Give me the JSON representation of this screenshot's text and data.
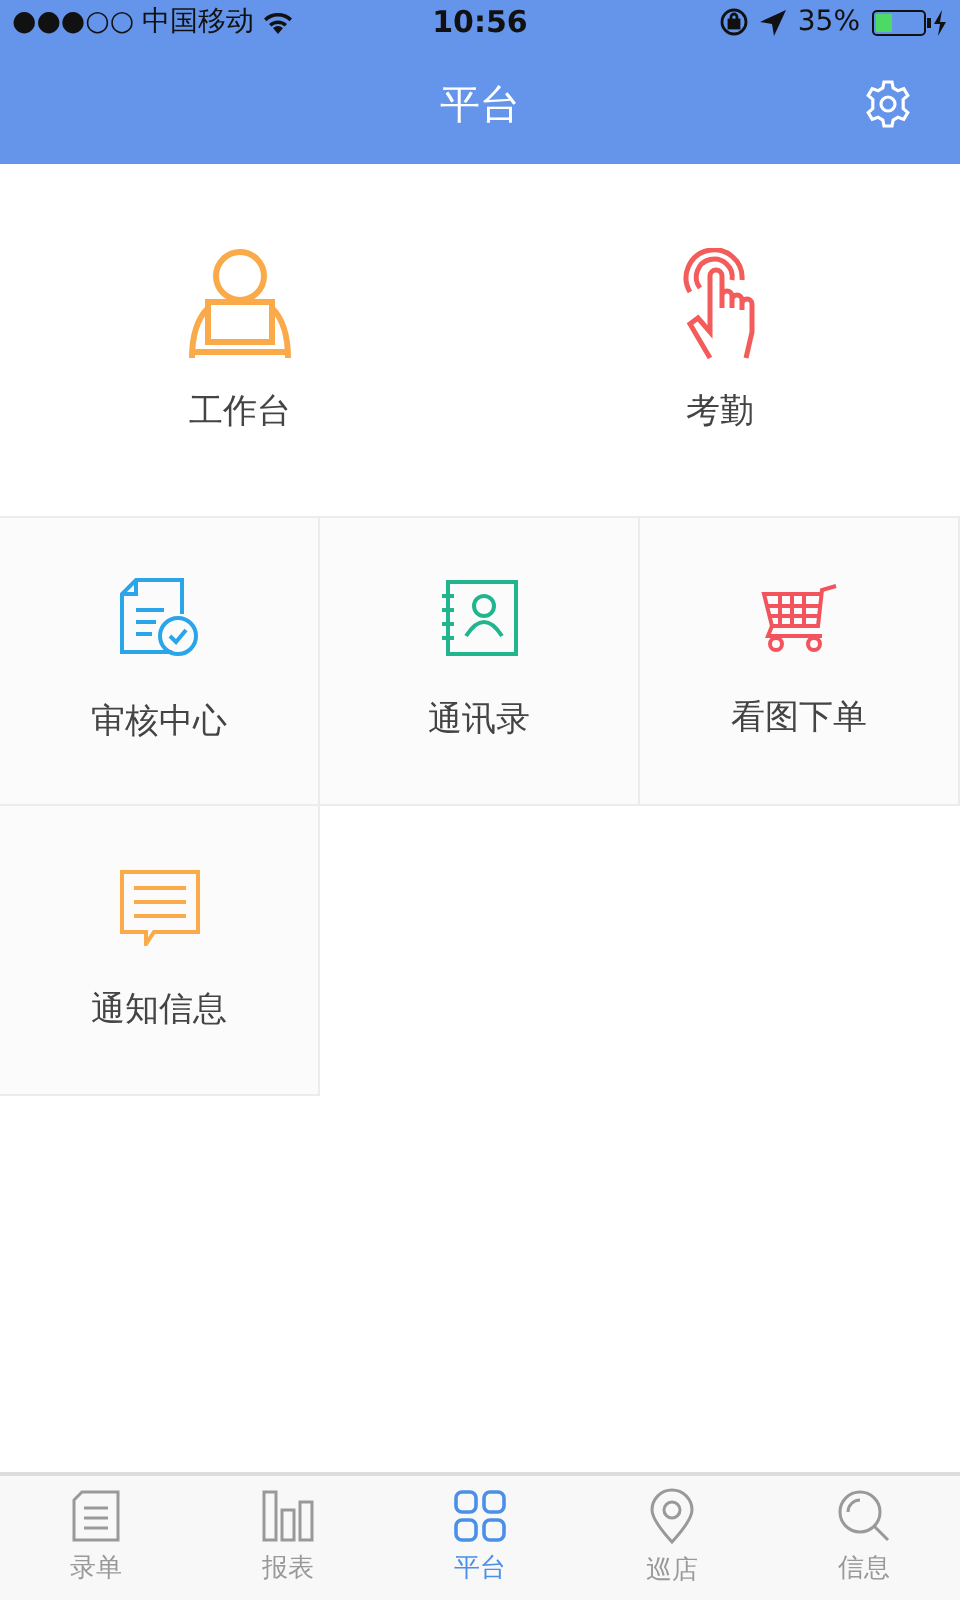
{
  "status_bar": {
    "signal": "●●●○○",
    "carrier": "中国移动",
    "time": "10:56",
    "battery": "35%"
  },
  "nav_bar": {
    "title": "平台"
  },
  "featured": [
    {
      "label": "工作台"
    },
    {
      "label": "考勤"
    }
  ],
  "tiles": [
    {
      "label": "审核中心"
    },
    {
      "label": "通讯录"
    },
    {
      "label": "看图下单"
    },
    {
      "label": "通知信息"
    }
  ],
  "tab_bar": [
    {
      "label": "录单",
      "selected": false
    },
    {
      "label": "报表",
      "selected": false
    },
    {
      "label": "平台",
      "selected": true
    },
    {
      "label": "巡店",
      "selected": false
    },
    {
      "label": "信息",
      "selected": false
    }
  ]
}
